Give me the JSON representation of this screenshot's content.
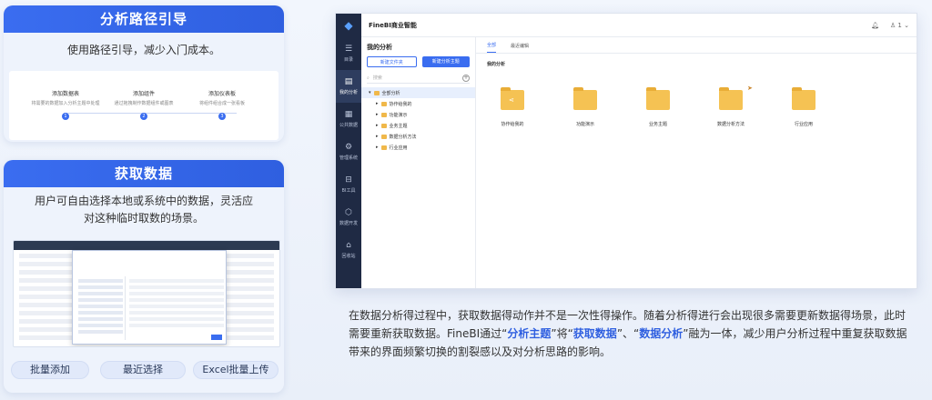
{
  "card1": {
    "title": "分析路径引导",
    "subtitle": "使用路径引导，减少入门成本。",
    "steps": [
      {
        "title": "添加数据表",
        "desc": "将需要的数据加入分析主题中处理",
        "num": "1"
      },
      {
        "title": "添加组件",
        "desc": "通过拖拽制作数据组件或图表",
        "num": "2"
      },
      {
        "title": "添加仪表板",
        "desc": "将组件组合成一张看板",
        "num": "3"
      }
    ]
  },
  "card2": {
    "title": "获取数据",
    "subtitle_line1": "用户可自由选择本地或系统中的数据，灵活应",
    "subtitle_line2": "对这种临时取数的场景。",
    "buttons": [
      "批量添加",
      "最近选择",
      "Excel批量上传"
    ]
  },
  "app": {
    "title": "FineBI商业智能",
    "user": "1",
    "nav": [
      {
        "label": "目录",
        "icon": "☰"
      },
      {
        "label": "我的分析",
        "icon": "▤"
      },
      {
        "label": "公共数据",
        "icon": "▦"
      },
      {
        "label": "管理系统",
        "icon": "⚙"
      },
      {
        "label": "BI工具",
        "icon": "⊟"
      },
      {
        "label": "数据开发",
        "icon": "⬡"
      },
      {
        "label": "回收站",
        "icon": "⌂"
      }
    ],
    "left_title": "我的分析",
    "btn_new_folder": "新建文件夹",
    "btn_new_subject": "新建分析主题",
    "search_placeholder": "搜索",
    "tree": [
      "全部分析",
      "协作给我的",
      "功能演示",
      "业务主题",
      "数据分析方法",
      "行业应用"
    ],
    "tabs": [
      "全部",
      "最近编辑"
    ],
    "main_label": "我的分析",
    "folders": [
      "协作给我的",
      "功能演示",
      "业务主题",
      "数据分析方法",
      "行业应用"
    ]
  },
  "description": {
    "p1": "在数据分析得过程中，获取数据得动作并不是一次性得操作。随着分析得进行会出现很多需要更新数据得场景，此时需要重新获取数据。FineBI通过“",
    "h1": "分析主题",
    "p2": "”将“",
    "h2": "获取数据",
    "p3": "”、“",
    "h3": "数据分析",
    "p4": "”融为一体，减少用户分析过程中重复获取数据带来的界面频繁切换的割裂感以及对分析思路的影响。"
  }
}
